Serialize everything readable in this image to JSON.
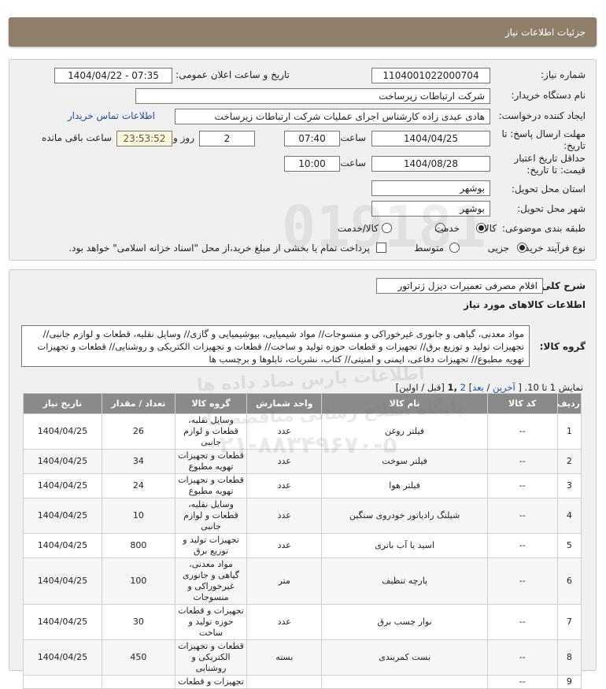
{
  "header": {
    "title": "جزئیات اطلاعات نیاز"
  },
  "form": {
    "need_number_label": "شماره نیاز:",
    "need_number": "1104001022000704",
    "announce_label": "تاریخ و ساعت اعلان عمومی:",
    "announce_value": "1404/04/22 - 07:35",
    "buyer_org_label": "نام دستگاه خریدار:",
    "buyer_org": "شرکت ارتباطات زیرساخت",
    "creator_label": "ایجاد کننده درخواست:",
    "creator": "هادی عبدی زاده کارشناس اجرای عملیات شرکت ارتباطات زیرساخت",
    "buyer_contact_link": "اطلاعات تماس خریدار",
    "deadline_label": "مهلت ارسال پاسخ: تا تاریخ:",
    "deadline_date": "1404/04/25",
    "time_label": "ساعت",
    "deadline_time": "07:40",
    "days_value": "2",
    "days_label": "روز و",
    "remaining_time": "23:53:52",
    "remaining_label": "ساعت باقی مانده",
    "price_validity_label": "حداقل تاریخ اعتبار قیمت: تا تاریخ:",
    "price_validity_date": "1404/08/28",
    "price_validity_time": "10:00",
    "province_label": "استان محل تحویل:",
    "province": "بوشهر",
    "city_label": "شهر محل تحویل:",
    "city": "بوشهر",
    "category_label": "طبقه بندی موضوعی:",
    "category_options": [
      "کالا",
      "خدمت",
      "کالا/خدمت"
    ],
    "category_selected": "کالا",
    "process_label": "نوع فرآیند خرید :",
    "process_options": [
      "جزیی",
      "متوسط"
    ],
    "process_selected": "جزیی",
    "payment_note": "پرداخت تمام یا بخشی از مبلغ خرید،از محل \"اسناد خزانه اسلامی\" خواهد بود."
  },
  "details": {
    "general_desc_label": "شرح کلی نیاز:",
    "general_desc": "اقلام مصرفی تعمیرات دیزل ژنراتور",
    "goods_info_title": "اطلاعات کالاهای مورد نیاز",
    "goods_group_label": "گروه کالا:",
    "goods_group_text": "مواد معدنی، گیاهی و جانوری غیرخوراکی و منسوجات// مواد شیمیایی، بیوشیمیایی و گازی// وسایل نقلیه، قطعات و لوازم جانبی// تجهیزات تولید و توزیع برق// تجهیزات و قطعات حوزه تولید و ساخت// قطعات و تجهیزات الکتریکی و روشنایی// قطعات و تجهیزات تهویه مطبوع// تجهیزات دفاعی، ایمنی و امنیتی// کتاب، نشریات، تابلوها و برچسب ها"
  },
  "pagination": {
    "prefix": "نمایش 1 تا 10. [",
    "last": "آخرین",
    "sep": "/",
    "next": "بعد",
    "page2": "2",
    "current": ",1",
    "rest": "[قبل / اولین]"
  },
  "watermark": {
    "line1": "پایگاه اطلاع رسانی مناقصه ها",
    "line2": "۰۲۱-۸۸۳۴۹۶۷۰-۵",
    "line3": "اطلاعات پارس نماد داده ها"
  },
  "table": {
    "headers": [
      "ردیف",
      "کد کالا",
      "نام کالا",
      "واحد شمارش",
      "گروه کالا",
      "تعداد / مقدار",
      "تاریخ نیاز"
    ],
    "rows": [
      [
        "1",
        "--",
        "فیلتر روغن",
        "عدد",
        "وسایل نقلیه، قطعات و لوازم جانبی",
        "26",
        "1404/04/25"
      ],
      [
        "2",
        "--",
        "فیلتر سوخت",
        "عدد",
        "قطعات و تجهیزات تهویه مطبوع",
        "34",
        "1404/04/25"
      ],
      [
        "3",
        "--",
        "فیلتر هوا",
        "عدد",
        "قطعات و تجهیزات تهویه مطبوع",
        "24",
        "1404/04/25"
      ],
      [
        "4",
        "--",
        "شیلنگ رادیاتور خودروی سنگین",
        "عدد",
        "وسایل نقلیه، قطعات و لوازم جانبی",
        "10",
        "1404/04/25"
      ],
      [
        "5",
        "--",
        "اسید یا آب باتری",
        "عدد",
        "تجهیزات تولید و توزیع برق",
        "800",
        "1404/04/25"
      ],
      [
        "6",
        "--",
        "پارچه تنظیف",
        "متر",
        "مواد معدنی، گیاهی و جانوری غیرخوراکی و منسوجات",
        "100",
        "1404/04/25"
      ],
      [
        "7",
        "--",
        "نوار چسب برق",
        "عدد",
        "تجهیزات و قطعات حوزه تولید و ساخت",
        "30",
        "1404/04/25"
      ],
      [
        "8",
        "--",
        "بست کمربندی",
        "بسته",
        "قطعات و تجهیزات الکتریکی و روشنایی",
        "450",
        "1404/04/25"
      ],
      [
        "9",
        "--",
        "",
        "",
        "تجهیزات و قطعات",
        "",
        ""
      ]
    ]
  }
}
